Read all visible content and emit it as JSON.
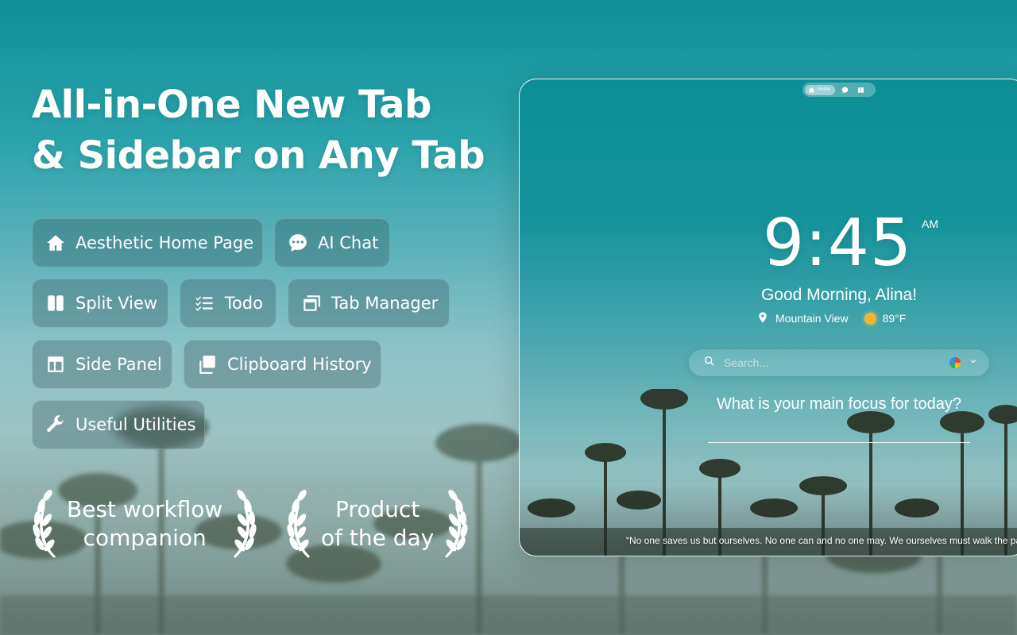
{
  "headline": {
    "line1": "All-in-One New Tab",
    "line2": "& Sidebar on Any Tab"
  },
  "features": [
    {
      "label": "Aesthetic Home Page",
      "icon": "home-icon"
    },
    {
      "label": "AI Chat",
      "icon": "chat-bubble-icon"
    },
    {
      "label": "Split View",
      "icon": "split-view-icon"
    },
    {
      "label": "Todo",
      "icon": "checklist-icon"
    },
    {
      "label": "Tab Manager",
      "icon": "tabs-icon"
    },
    {
      "label": "Side Panel",
      "icon": "side-panel-icon"
    },
    {
      "label": "Clipboard History",
      "icon": "clipboard-icon"
    },
    {
      "label": "Useful Utilities",
      "icon": "wrench-icon"
    }
  ],
  "awards": [
    {
      "line1": "Best workflow",
      "line2": "companion"
    },
    {
      "line1": "Product",
      "line2": "of the day"
    }
  ],
  "preview": {
    "topbar": {
      "home_label": "Home"
    },
    "clock": {
      "time": "9:45",
      "ampm": "AM"
    },
    "greeting": "Good Morning, Alina!",
    "weather": {
      "location": "Mountain View",
      "temperature": "89°F"
    },
    "search": {
      "placeholder": "Search..."
    },
    "focus_question": "What is your main focus for today?",
    "quote": "“No one saves us but ourselves. No one can and no one may. We ourselves must walk the path.”"
  },
  "colors": {
    "sun": "#f2b532",
    "chip_bg": "rgba(40,70,75,0.28)"
  }
}
